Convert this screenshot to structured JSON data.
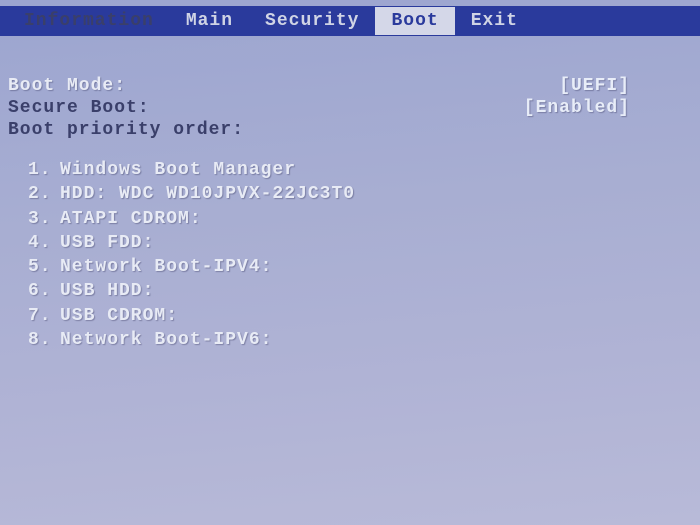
{
  "menu": {
    "tabs": [
      {
        "label": "Information"
      },
      {
        "label": "Main"
      },
      {
        "label": "Security"
      },
      {
        "label": "Boot"
      },
      {
        "label": "Exit"
      }
    ],
    "active_index": 3
  },
  "settings": {
    "boot_mode": {
      "label": "Boot Mode:",
      "value": "[UEFI]"
    },
    "secure_boot": {
      "label": "Secure Boot:",
      "value": "[Enabled]"
    },
    "priority_label": "Boot priority order:"
  },
  "boot_order": [
    {
      "num": "1.",
      "text": "Windows Boot Manager"
    },
    {
      "num": "2.",
      "text": "HDD: WDC WD10JPVX-22JC3T0"
    },
    {
      "num": "3.",
      "text": "ATAPI CDROM:"
    },
    {
      "num": "4.",
      "text": "USB FDD:"
    },
    {
      "num": "5.",
      "text": "Network Boot-IPV4:"
    },
    {
      "num": "6.",
      "text": "USB HDD:"
    },
    {
      "num": "7.",
      "text": "USB CDROM:"
    },
    {
      "num": "8.",
      "text": "Network Boot-IPV6:"
    }
  ]
}
